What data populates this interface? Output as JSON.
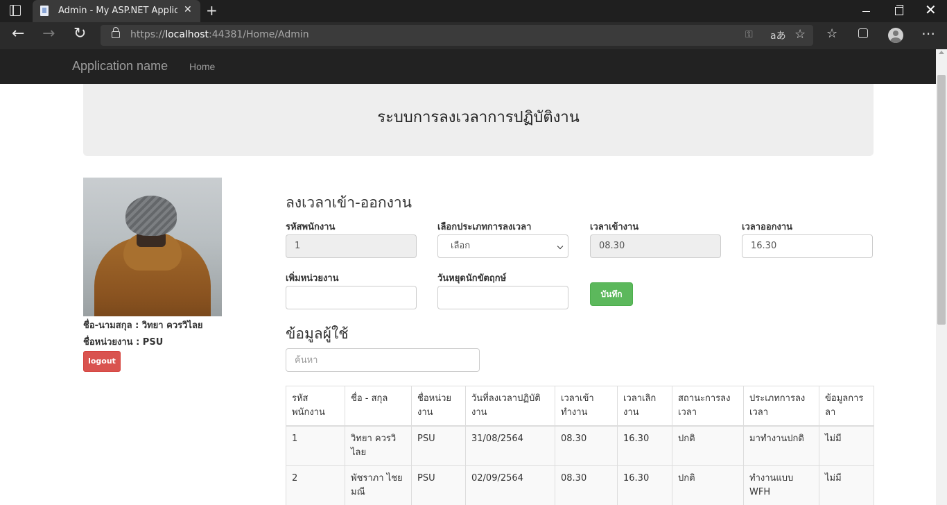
{
  "browser": {
    "tab_title": "Admin - My ASP.NET Application",
    "url_scheme": "https://",
    "url_host": "localhost",
    "url_rest": ":44381/Home/Admin",
    "read_aloud_icon_text": "aあ"
  },
  "navbar": {
    "brand": "Application name",
    "home": "Home"
  },
  "jumbotron": {
    "title": "ระบบการลงเวลาการปฏิบัติงาน"
  },
  "profile": {
    "name_label": "ชื่อ-นามสกุล : ",
    "name_value": "วิทยา ควรวิไลย",
    "unit_label": "ชื่อหน่วยงาน : ",
    "unit_value": "PSU",
    "logout": "logout"
  },
  "form": {
    "title": "ลงเวลาเข้า-ออกงาน",
    "employee_id_label": "รหัสพนักงาน",
    "employee_id_value": "1",
    "type_label": "เลือกประเภทการลงเวลา",
    "type_value": "เลือก",
    "time_in_label": "เวลาเข้างาน",
    "time_in_value": "08.30",
    "time_out_label": "เวลาออกงาน",
    "time_out_value": "16.30",
    "add_unit_label": "เพิ่มหน่วยงาน",
    "add_unit_value": "",
    "holiday_label": "วันหยุดนักขัตฤกษ์",
    "holiday_value": "",
    "save": "บันทึก"
  },
  "users": {
    "title": "ข้อมูลผู้ใช้",
    "search_placeholder": "ค้นหา",
    "columns": [
      "รหัสพนักงาน",
      "ชื่อ - สกุล",
      "ชื่อหน่วยงาน",
      "วันที่ลงเวลาปฏิบัติงาน",
      "เวลาเข้าทำงาน",
      "เวลาเลิกงาน",
      "สถานะการลงเวลา",
      "ประเภทการลงเวลา",
      "ข้อมูลการลา"
    ],
    "rows": [
      [
        "1",
        "วิทยา ควรวิไลย",
        "PSU",
        "31/08/2564",
        "08.30",
        "16.30",
        "ปกติ",
        "มาทำงานปกติ",
        "ไม่มี"
      ],
      [
        "2",
        "พัชราภา ไชยมณี",
        "PSU",
        "02/09/2564",
        "08.30",
        "16.30",
        "ปกติ",
        "ทำงานแบบ WFH",
        "ไม่มี"
      ]
    ]
  },
  "colors": {
    "navbar_bg": "#222222",
    "logout_btn": "#d9534f",
    "save_btn": "#5cb85c",
    "jumbotron_bg": "#eeeeee"
  }
}
